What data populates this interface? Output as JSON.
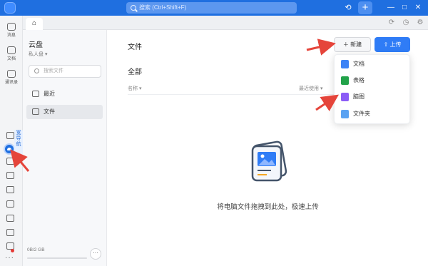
{
  "topbar": {
    "search_placeholder": "搜索 (Ctrl+Shift+F)",
    "plus_label": "+",
    "history_icon": "clock-icon",
    "window_controls": [
      "—",
      "□",
      "✕"
    ]
  },
  "rail": {
    "items": [
      {
        "label": "消息",
        "icon": "message-icon"
      },
      {
        "label": "文档",
        "icon": "document-icon"
      },
      {
        "label": "通讯录",
        "icon": "contacts-icon"
      }
    ],
    "tooltip": "宽导航"
  },
  "tabbar": {
    "home_icon": "⌂"
  },
  "sidebar": {
    "title": "云盘",
    "subtitle": "私人盘 ▾",
    "search_placeholder": "搜索文件",
    "nav": [
      {
        "label": "最近",
        "icon": "home-icon",
        "active": false
      },
      {
        "label": "文件",
        "icon": "folder-icon",
        "active": true
      }
    ],
    "storage_text": "0B/2 GB",
    "storage_fraction": 0.0,
    "more_label": "···"
  },
  "main": {
    "title": "文件",
    "new_button": "＋ 新建",
    "upload_button": "⇧ 上传",
    "section_title": "全部",
    "col_name": "名称 ▾",
    "col_recent": "最近使用 ▾",
    "empty_text": "将电脑文件拖拽到此处，极速上传"
  },
  "dropdown": {
    "items": [
      {
        "label": "文档",
        "icon": "doc-icon",
        "color": "#3b82f6"
      },
      {
        "label": "表格",
        "icon": "sheet-icon",
        "color": "#22a34a"
      },
      {
        "label": "脑图",
        "icon": "mindmap-icon",
        "color": "#8b5cf6"
      },
      {
        "label": "文件夹",
        "icon": "folder-icon",
        "color": "#5aa2f2"
      }
    ]
  },
  "colors": {
    "brand": "#1f6fe0",
    "arrow": "#e5453b"
  }
}
